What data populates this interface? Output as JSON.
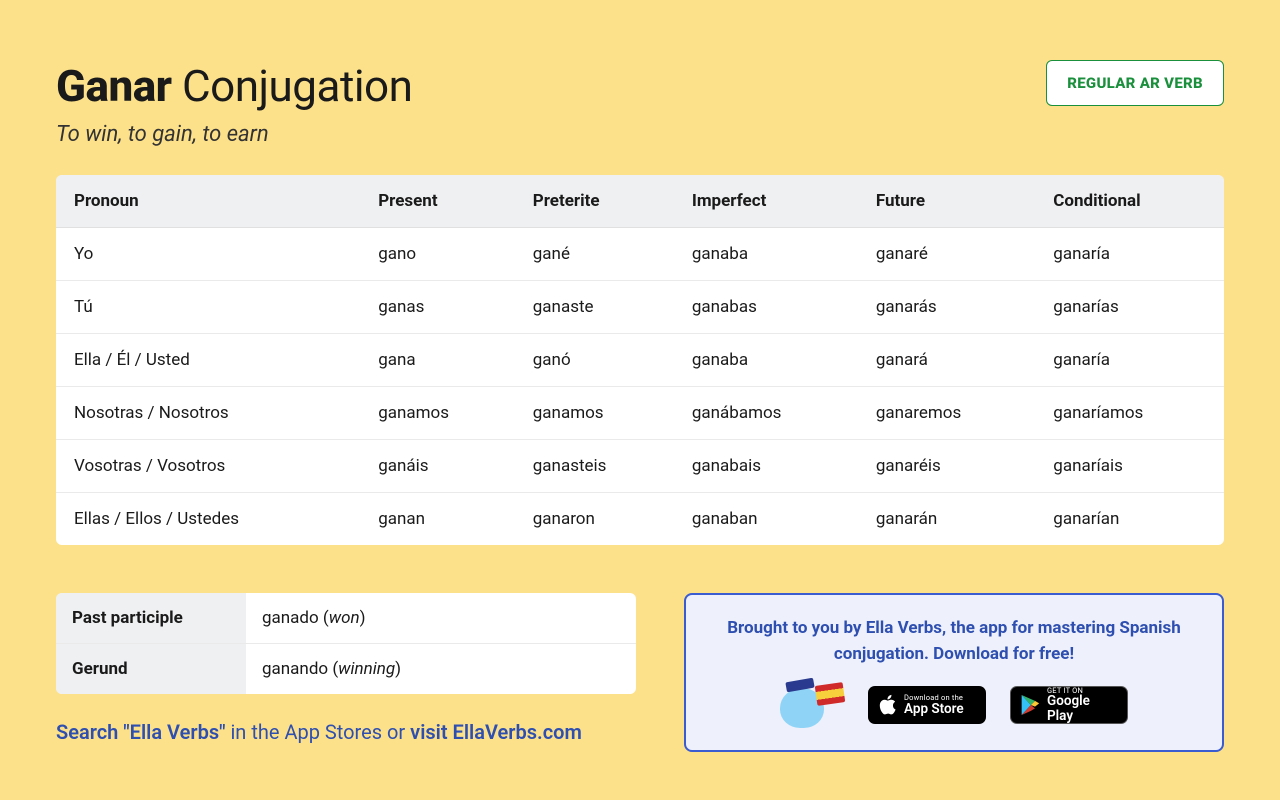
{
  "header": {
    "verb": "Ganar",
    "title_rest": "Conjugation",
    "subtitle": "To win, to gain, to earn",
    "badge": "REGULAR AR VERB"
  },
  "table": {
    "headers": [
      "Pronoun",
      "Present",
      "Preterite",
      "Imperfect",
      "Future",
      "Conditional"
    ],
    "rows": [
      [
        "Yo",
        "gano",
        "gané",
        "ganaba",
        "ganaré",
        "ganaría"
      ],
      [
        "Tú",
        "ganas",
        "ganaste",
        "ganabas",
        "ganarás",
        "ganarías"
      ],
      [
        "Ella / Él / Usted",
        "gana",
        "ganó",
        "ganaba",
        "ganará",
        "ganaría"
      ],
      [
        "Nosotras / Nosotros",
        "ganamos",
        "ganamos",
        "ganábamos",
        "ganaremos",
        "ganaríamos"
      ],
      [
        "Vosotras / Vosotros",
        "ganáis",
        "ganasteis",
        "ganabais",
        "ganaréis",
        "ganaríais"
      ],
      [
        "Ellas / Ellos / Ustedes",
        "ganan",
        "ganaron",
        "ganaban",
        "ganarán",
        "ganarían"
      ]
    ]
  },
  "participles": {
    "past_label": "Past participle",
    "past_value": "ganado (",
    "past_ital": "won",
    "past_close": ")",
    "gerund_label": "Gerund",
    "gerund_value": "ganando (",
    "gerund_ital": "winning",
    "gerund_close": ")"
  },
  "search_line": {
    "a": "Search \"Ella Verbs\"",
    "b": " in the App Stores or ",
    "c": "visit EllaVerbs.com"
  },
  "promo": {
    "text": "Brought to you by Ella Verbs, the app for mastering Spanish conjugation. Download for free!",
    "apple_small": "Download on the",
    "apple_big": "App Store",
    "google_small": "GET IT ON",
    "google_big": "Google Play"
  }
}
